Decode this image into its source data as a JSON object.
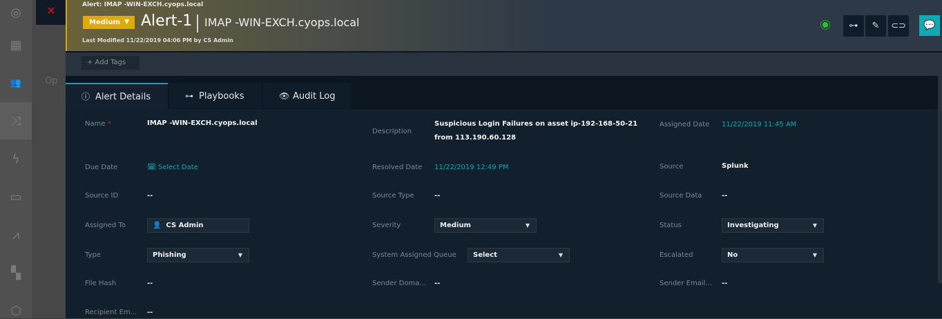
{
  "header": {
    "breadcrumb": "Alert: IMAP -WIN-EXCH.cyops.local",
    "severity": "Medium",
    "title": "Alert-1",
    "subtitle": "IMAP -WIN-EXCH.cyops.local",
    "last_modified": "Last Modified 11/22/2019 04:06 PM by CS Admin",
    "status_color": "#29c12d"
  },
  "background": {
    "partial_text": "Op"
  },
  "tags": {
    "add_label": "+ Add Tags"
  },
  "tabs": [
    {
      "label": "Alert Details"
    },
    {
      "label": "Playbooks"
    },
    {
      "label": "Audit Log"
    }
  ],
  "fields": {
    "name": {
      "label": "Name",
      "value": "IMAP -WIN-EXCH.cyops.local"
    },
    "description": {
      "label": "Description",
      "value": "Suspicious Login Failures on asset ip-192-168-50-21 from 113.190.60.128"
    },
    "assigned_date": {
      "label": "Assigned Date",
      "value": "11/22/2019 11:45 AM"
    },
    "due_date": {
      "label": "Due Date",
      "value": "Select Date"
    },
    "resolved_date": {
      "label": "Resolved Date",
      "value": "11/22/2019 12:49 PM"
    },
    "source": {
      "label": "Source",
      "value": "Splunk"
    },
    "source_id": {
      "label": "Source ID",
      "value": "--"
    },
    "source_type": {
      "label": "Source Type",
      "value": "--"
    },
    "source_data": {
      "label": "Source Data",
      "value": "--"
    },
    "assigned_to": {
      "label": "Assigned To",
      "value": "CS Admin"
    },
    "severity": {
      "label": "Severity",
      "value": "Medium"
    },
    "status": {
      "label": "Status",
      "value": "Investigating"
    },
    "type": {
      "label": "Type",
      "value": "Phishing"
    },
    "queue": {
      "label": "System Assigned Queue",
      "value": "Select"
    },
    "escalated": {
      "label": "Escalated",
      "value": "No"
    },
    "file_hash": {
      "label": "File Hash",
      "value": "--"
    },
    "sender_domain": {
      "label": "Sender Doma...",
      "value": "--"
    },
    "sender_email": {
      "label": "Sender Email...",
      "value": "--"
    },
    "recipient_email": {
      "label": "Recipient Em...",
      "value": "--"
    }
  }
}
